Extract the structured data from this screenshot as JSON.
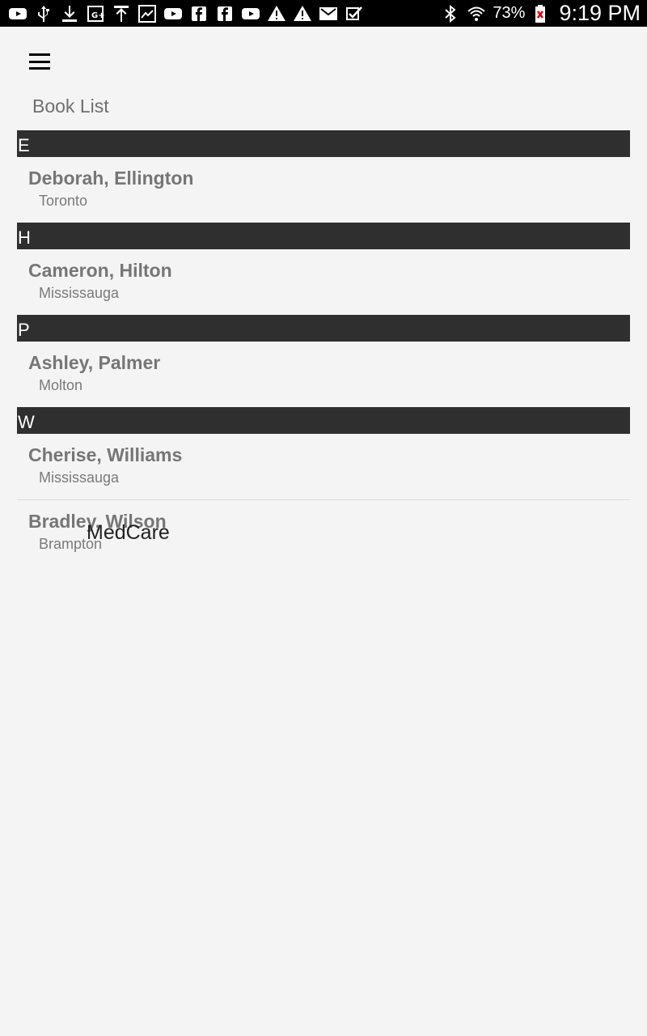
{
  "status_bar": {
    "notification_icons": [
      "youtube-icon",
      "usb-icon",
      "download-icon",
      "google-plus-icon",
      "upload-icon",
      "image-icon",
      "youtube-icon",
      "facebook-icon",
      "facebook-icon",
      "youtube-icon",
      "warning-icon",
      "warning-icon",
      "gmail-icon",
      "checkbox-icon"
    ],
    "right_icons": [
      "bluetooth-icon",
      "wifi-icon"
    ],
    "battery_percent": "73%",
    "time": "9:19 PM"
  },
  "toolbar": {
    "menu_icon": "hamburger-menu-icon",
    "title": "Book List"
  },
  "sections": [
    {
      "letter": "E",
      "contacts": [
        {
          "name": "Deborah, Ellington",
          "city": "Toronto"
        }
      ]
    },
    {
      "letter": "H",
      "contacts": [
        {
          "name": "Cameron, Hilton",
          "city": "Mississauga"
        }
      ]
    },
    {
      "letter": "P",
      "contacts": [
        {
          "name": "Ashley, Palmer",
          "city": "Molton"
        }
      ]
    },
    {
      "letter": "W",
      "contacts": [
        {
          "name": "Cherise, Williams",
          "city": "Mississauga"
        },
        {
          "name": "Bradley, Wilson",
          "city": "Brampton"
        }
      ]
    }
  ],
  "overlay_label": "MedCare"
}
